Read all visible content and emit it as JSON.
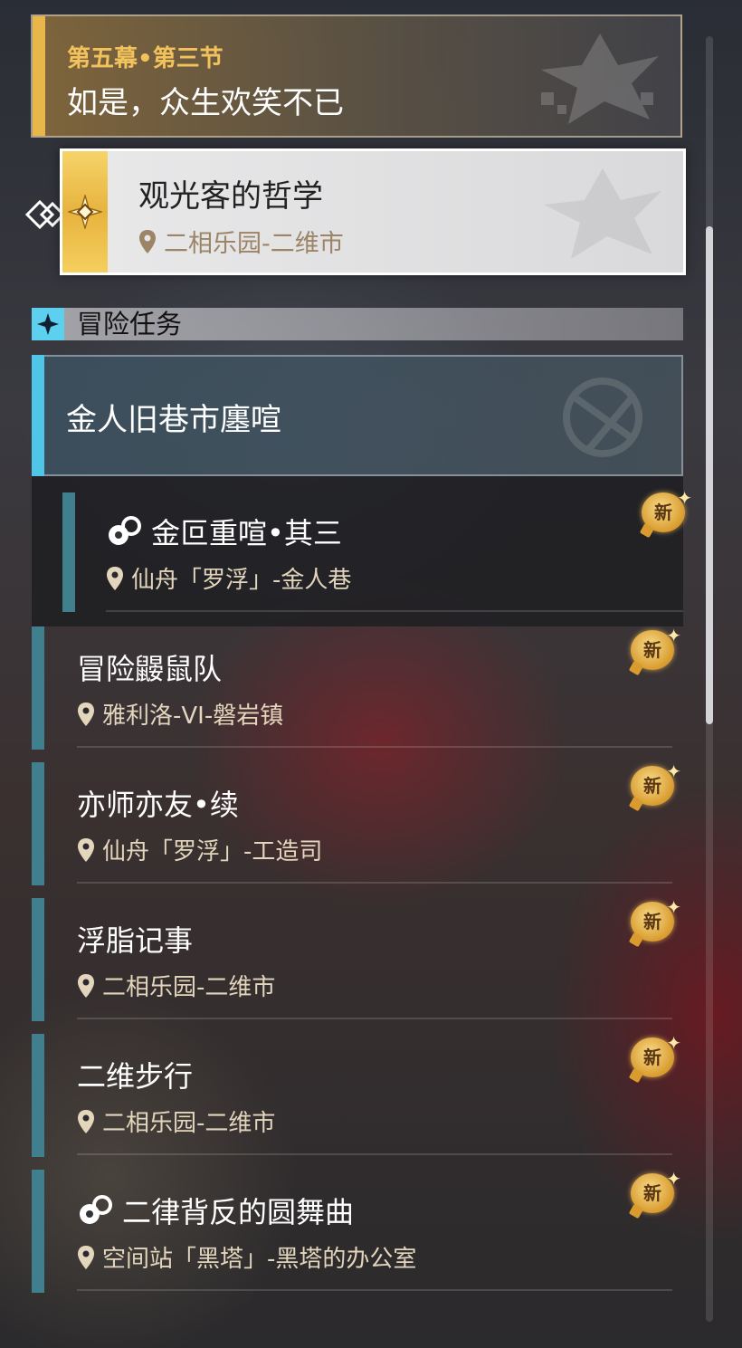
{
  "main_quest": {
    "chapter": "第五幕•第三节",
    "title": "如是，众生欢笑不已",
    "accent_color": "#e8b64a"
  },
  "current_quest": {
    "title": "观光客的哲学",
    "location": "二相乐园-二维市",
    "icon": "star-compass-icon",
    "selector_icon": "selected-arrow-icon"
  },
  "section": {
    "label": "冒险任务",
    "icon": "sparkle-icon",
    "accent_color": "#5ed0ef"
  },
  "group": {
    "title": "金人旧巷市廛喧",
    "items": [
      {
        "title": "金叵重喧•其三",
        "location": "仙舟「罗浮」-金人巷",
        "badge": "新",
        "icon": "sub-quest-icon"
      }
    ]
  },
  "quests": [
    {
      "title": "冒险鼹鼠队",
      "location": "雅利洛-VI-磐岩镇",
      "badge": "新"
    },
    {
      "title": "亦师亦友•续",
      "location": "仙舟「罗浮」-工造司",
      "badge": "新"
    },
    {
      "title": "浮脂记事",
      "location": "二相乐园-二维市",
      "badge": "新"
    },
    {
      "title": "二维步行",
      "location": "二相乐园-二维市",
      "badge": "新"
    },
    {
      "title": "二律背反的圆舞曲",
      "location": "空间站「黑塔」-黑塔的办公室",
      "badge": "新",
      "icon": "sub-quest-icon"
    }
  ],
  "colors": {
    "quest_bar": "#3f7f8e",
    "location_text": "#e3d6bd",
    "badge_gold": "#d99b2e"
  }
}
